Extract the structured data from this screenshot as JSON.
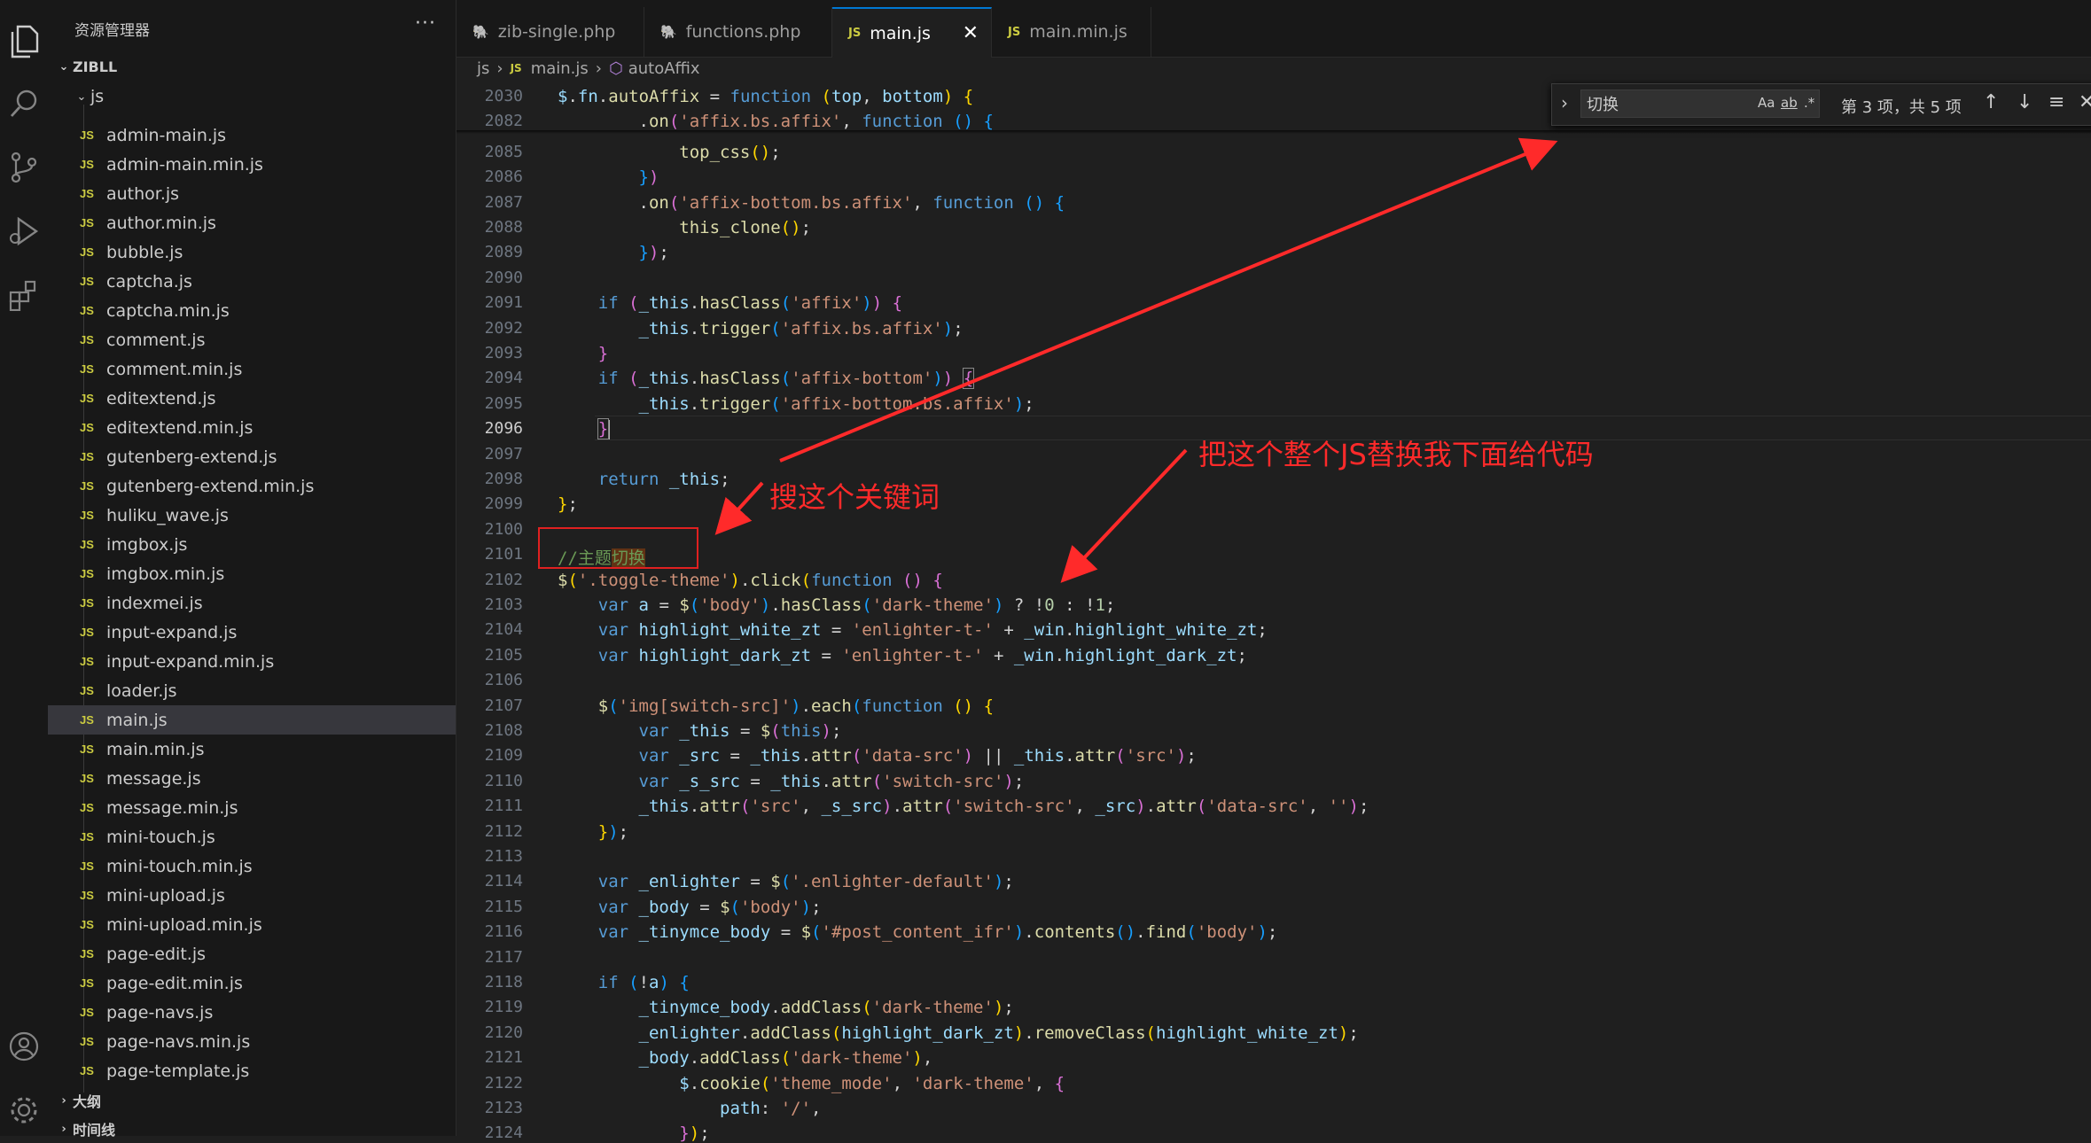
{
  "sidebar": {
    "title": "资源管理器",
    "more": "···",
    "root": "ZIBLL",
    "folder": "js",
    "files": [
      "admin-main.js",
      "admin-main.min.js",
      "author.js",
      "author.min.js",
      "bubble.js",
      "captcha.js",
      "captcha.min.js",
      "comment.js",
      "comment.min.js",
      "editextend.js",
      "editextend.min.js",
      "gutenberg-extend.js",
      "gutenberg-extend.min.js",
      "huliku_wave.js",
      "imgbox.js",
      "imgbox.min.js",
      "indexmei.js",
      "input-expand.js",
      "input-expand.min.js",
      "loader.js",
      "main.js",
      "main.min.js",
      "message.js",
      "message.min.js",
      "mini-touch.js",
      "mini-touch.min.js",
      "mini-upload.js",
      "mini-upload.min.js",
      "page-edit.js",
      "page-edit.min.js",
      "page-navs.js",
      "page-navs.min.js",
      "page-template.js"
    ],
    "selected": "main.js",
    "file_badge": "JS",
    "outline": "大纲",
    "timeline": "时间线"
  },
  "tabs": [
    {
      "label": "zib-single.php",
      "icon": "php-icon"
    },
    {
      "label": "functions.php",
      "icon": "php-icon"
    },
    {
      "label": "main.js",
      "icon": "js-icon",
      "active": true
    },
    {
      "label": "main.min.js",
      "icon": "js-icon"
    }
  ],
  "tab_badge": "JS",
  "tab_close": "✕",
  "breadcrumb": {
    "folder": "js",
    "file": "main.js",
    "symbol": "autoAffix",
    "sep": "›"
  },
  "find": {
    "query": "切换",
    "case": "Aa",
    "word": "ab",
    "regex": ".*",
    "count": "第 3 项，共 5 项"
  },
  "editor": {
    "current_line": "2096",
    "lines": [
      {
        "n": "2030",
        "h": "<span class='v'>$</span>.<span class='v'>fn</span>.<span class='f'>autoAffix</span> = <span class='k'>function</span> <span class='p1'>(</span><span class='v'>top</span>, <span class='v'>bottom</span><span class='p1'>)</span> <span class='p1'>{</span>"
      },
      {
        "n": "2082",
        "h": "        .<span class='f'>on</span><span class='p2'>(</span><span class='s'>'affix.bs.affix'</span>, <span class='k'>function</span> <span class='p3'>()</span> <span class='p3'>{</span>"
      },
      {
        "n": "2085",
        "h": "            <span class='f'>top_css</span><span class='p1'>()</span>;"
      },
      {
        "n": "2086",
        "h": "        <span class='p3'>}</span><span class='p2'>)</span>"
      },
      {
        "n": "2087",
        "h": "        .<span class='f'>on</span><span class='p2'>(</span><span class='s'>'affix-bottom.bs.affix'</span>, <span class='k'>function</span> <span class='p3'>()</span> <span class='p3'>{</span>"
      },
      {
        "n": "2088",
        "h": "            <span class='f'>this_clone</span><span class='p1'>()</span>;"
      },
      {
        "n": "2089",
        "h": "        <span class='p3'>}</span><span class='p2'>)</span>;"
      },
      {
        "n": "2090",
        "h": ""
      },
      {
        "n": "2091",
        "h": "    <span class='k'>if</span> <span class='p2'>(</span><span class='v'>_this</span>.<span class='f'>hasClass</span><span class='p3'>(</span><span class='s'>'affix'</span><span class='p3'>)</span><span class='p2'>)</span> <span class='p2'>{</span>"
      },
      {
        "n": "2092",
        "h": "        <span class='v'>_this</span>.<span class='f'>trigger</span><span class='p3'>(</span><span class='s'>'affix.bs.affix'</span><span class='p3'>)</span>;"
      },
      {
        "n": "2093",
        "h": "    <span class='p2'>}</span>"
      },
      {
        "n": "2094",
        "h": "    <span class='k'>if</span> <span class='p2'>(</span><span class='v'>_this</span>.<span class='f'>hasClass</span><span class='p3'>(</span><span class='s'>'affix-bottom'</span><span class='p3'>)</span><span class='p2'>)</span> <span class='p2 bm'>{</span>"
      },
      {
        "n": "2095",
        "h": "        <span class='v'>_this</span>.<span class='f'>trigger</span><span class='p3'>(</span><span class='s'>'affix-bottom.bs.affix'</span><span class='p3'>)</span>;"
      },
      {
        "n": "2096",
        "h": "    <span class='p2 bm'>}</span><span class='cursor'></span>"
      },
      {
        "n": "2097",
        "h": ""
      },
      {
        "n": "2098",
        "h": "    <span class='k'>return</span> <span class='v'>_this</span>;"
      },
      {
        "n": "2099",
        "h": "<span class='p1'>}</span>;"
      },
      {
        "n": "2100",
        "h": ""
      },
      {
        "n": "2101",
        "h": "<span class='c'>//主题<span class='hl'>切换</span></span>"
      },
      {
        "n": "2102",
        "h": "<span class='f'>$</span><span class='p1'>(</span><span class='s'>'.toggle-theme'</span><span class='p1'>)</span>.<span class='f'>click</span><span class='p1'>(</span><span class='k'>function</span> <span class='p2'>()</span> <span class='p2'>{</span>"
      },
      {
        "n": "2103",
        "h": "    <span class='k'>var</span> <span class='v'>a</span> = <span class='f'>$</span><span class='p3'>(</span><span class='s'>'body'</span><span class='p3'>)</span>.<span class='f'>hasClass</span><span class='p3'>(</span><span class='s'>'dark-theme'</span><span class='p3'>)</span> ? !<span class='n'>0</span> : !<span class='n'>1</span>;"
      },
      {
        "n": "2104",
        "h": "    <span class='k'>var</span> <span class='v'>highlight_white_zt</span> = <span class='s'>'enlighter-t-'</span> + <span class='v'>_win</span>.<span class='v'>highlight_white_zt</span>;"
      },
      {
        "n": "2105",
        "h": "    <span class='k'>var</span> <span class='v'>highlight_dark_zt</span> = <span class='s'>'enlighter-t-'</span> + <span class='v'>_win</span>.<span class='v'>highlight_dark_zt</span>;"
      },
      {
        "n": "2106",
        "h": ""
      },
      {
        "n": "2107",
        "h": "    <span class='f'>$</span><span class='p3'>(</span><span class='s'>'img[switch-src]'</span><span class='p3'>)</span>.<span class='f'>each</span><span class='p3'>(</span><span class='k'>function</span> <span class='p1'>()</span> <span class='p1'>{</span>"
      },
      {
        "n": "2108",
        "h": "        <span class='k'>var</span> <span class='v'>_this</span> = <span class='f'>$</span><span class='p2'>(</span><span class='k'>this</span><span class='p2'>)</span>;"
      },
      {
        "n": "2109",
        "h": "        <span class='k'>var</span> <span class='v'>_src</span> = <span class='v'>_this</span>.<span class='f'>attr</span><span class='p2'>(</span><span class='s'>'data-src'</span><span class='p2'>)</span> || <span class='v'>_this</span>.<span class='f'>attr</span><span class='p2'>(</span><span class='s'>'src'</span><span class='p2'>)</span>;"
      },
      {
        "n": "2110",
        "h": "        <span class='k'>var</span> <span class='v'>_s_src</span> = <span class='v'>_this</span>.<span class='f'>attr</span><span class='p2'>(</span><span class='s'>'switch-src'</span><span class='p2'>)</span>;"
      },
      {
        "n": "2111",
        "h": "        <span class='v'>_this</span>.<span class='f'>attr</span><span class='p2'>(</span><span class='s'>'src'</span>, <span class='v'>_s_src</span><span class='p2'>)</span>.<span class='f'>attr</span><span class='p2'>(</span><span class='s'>'switch-src'</span>, <span class='v'>_src</span><span class='p2'>)</span>.<span class='f'>attr</span><span class='p2'>(</span><span class='s'>'data-src'</span>, <span class='s'>''</span><span class='p2'>)</span>;"
      },
      {
        "n": "2112",
        "h": "    <span class='p1'>}</span><span class='p3'>)</span>;"
      },
      {
        "n": "2113",
        "h": ""
      },
      {
        "n": "2114",
        "h": "    <span class='k'>var</span> <span class='v'>_enlighter</span> = <span class='f'>$</span><span class='p3'>(</span><span class='s'>'.enlighter-default'</span><span class='p3'>)</span>;"
      },
      {
        "n": "2115",
        "h": "    <span class='k'>var</span> <span class='v'>_body</span> = <span class='f'>$</span><span class='p3'>(</span><span class='s'>'body'</span><span class='p3'>)</span>;"
      },
      {
        "n": "2116",
        "h": "    <span class='k'>var</span> <span class='v'>_tinymce_body</span> = <span class='f'>$</span><span class='p3'>(</span><span class='s'>'#post_content_ifr'</span><span class='p3'>)</span>.<span class='f'>contents</span><span class='p3'>()</span>.<span class='f'>find</span><span class='p3'>(</span><span class='s'>'body'</span><span class='p3'>)</span>;"
      },
      {
        "n": "2117",
        "h": ""
      },
      {
        "n": "2118",
        "h": "    <span class='k'>if</span> <span class='p3'>(</span>!<span class='v'>a</span><span class='p3'>)</span> <span class='p3'>{</span>"
      },
      {
        "n": "2119",
        "h": "        <span class='v'>_tinymce_body</span>.<span class='f'>addClass</span><span class='p1'>(</span><span class='s'>'dark-theme'</span><span class='p1'>)</span>;"
      },
      {
        "n": "2120",
        "h": "        <span class='v'>_enlighter</span>.<span class='f'>addClass</span><span class='p1'>(</span><span class='v'>highlight_dark_zt</span><span class='p1'>)</span>.<span class='f'>removeClass</span><span class='p1'>(</span><span class='v'>highlight_white_zt</span><span class='p1'>)</span>;"
      },
      {
        "n": "2121",
        "h": "        <span class='v'>_body</span>.<span class='f'>addClass</span><span class='p1'>(</span><span class='s'>'dark-theme'</span><span class='p1'>)</span>,"
      },
      {
        "n": "2122",
        "h": "            <span class='v'>$</span>.<span class='f'>cookie</span><span class='p1'>(</span><span class='s'>'theme_mode'</span>, <span class='s'>'dark-theme'</span>, <span class='p2'>{</span>"
      },
      {
        "n": "2123",
        "h": "                <span class='v'>path</span>: <span class='s'>'/'</span>,"
      },
      {
        "n": "2124",
        "h": "            <span class='p2'>}</span><span class='p1'>)</span>;"
      }
    ]
  },
  "annotations": {
    "search_hint": "搜这个关键词",
    "replace_hint": "把这个整个JS替换我下面给代码",
    "arrow_color": "#ff2a2a"
  }
}
